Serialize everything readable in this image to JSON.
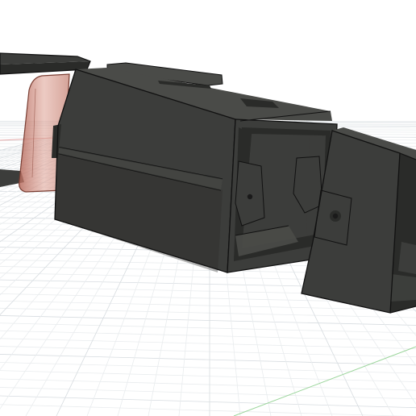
{
  "viewport": {
    "mode": "3d-model-view",
    "background_color": "#ffffff",
    "grid_color": "#d7dce0",
    "grid_minor_color": "#e9ecee",
    "axis_x_color": "#e3a7a7",
    "axis_y_color": "#9bd59b"
  },
  "model": {
    "body_color": "#3c3d3b",
    "body_dark_color": "#2a2b29",
    "body_light_color": "#4a4b48",
    "edge_color": "#111111",
    "translucent_color": "#c98a7e",
    "hole_color": "#1a1a1a"
  }
}
